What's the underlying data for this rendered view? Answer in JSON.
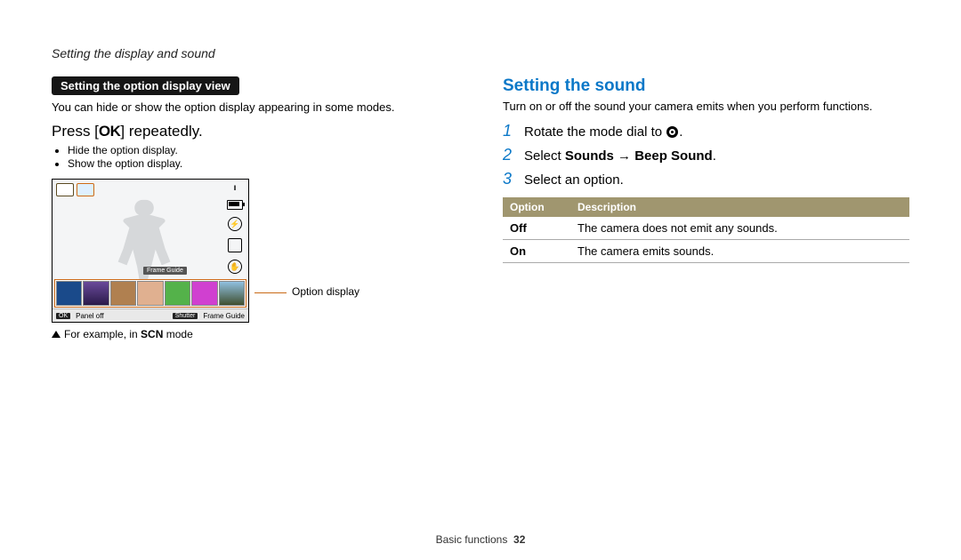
{
  "header": {
    "breadcrumb": "Setting the display and sound"
  },
  "left": {
    "pill": "Setting the option display view",
    "intro": "You can hide or show the option display appearing in some modes.",
    "press_pre": "Press [",
    "press_ok": "OK",
    "press_post": "] repeatedly.",
    "bullets": [
      "Hide the option display.",
      "Show the option display."
    ],
    "lcd": {
      "frame_guide": "Frame Guide",
      "panel_off_tag": "OK",
      "panel_off": "Panel off",
      "shutter_tag": "Shutter",
      "shutter_text": "Frame Guide"
    },
    "callout": "Option display",
    "example_pre": "For example, in ",
    "example_mode": "SCN",
    "example_post": " mode"
  },
  "right": {
    "heading": "Setting the sound",
    "intro": "Turn on or off the sound your camera emits when you perform functions.",
    "steps": {
      "s1_pre": "Rotate the mode dial to ",
      "s1_post": ".",
      "s2_pre": "Select ",
      "s2_b1": "Sounds",
      "s2_arrow": " → ",
      "s2_b2": "Beep Sound",
      "s2_post": ".",
      "s3": "Select an option."
    },
    "table": {
      "head_option": "Option",
      "head_desc": "Description",
      "rows": [
        {
          "opt": "Off",
          "desc": "The camera does not emit any sounds."
        },
        {
          "opt": "On",
          "desc": "The camera emits sounds."
        }
      ]
    }
  },
  "footer": {
    "section": "Basic functions",
    "page": "32"
  }
}
